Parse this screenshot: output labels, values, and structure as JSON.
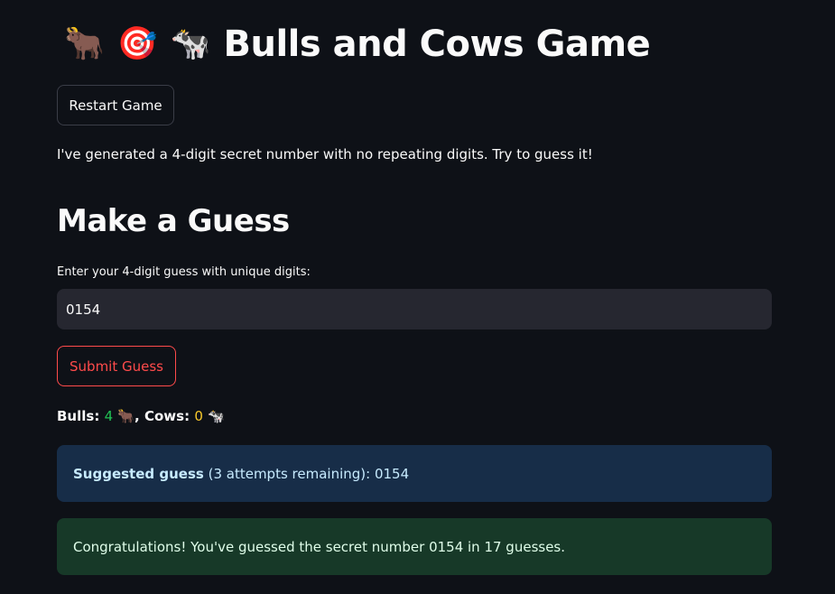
{
  "header": {
    "icons": [
      "bull-emoji",
      "dart-target-emoji",
      "cow-emoji"
    ],
    "icon_glyphs": [
      "🐂",
      "🎯",
      "🐄"
    ],
    "title": "Bulls and Cows Game"
  },
  "restart_button": {
    "label": "Restart Game"
  },
  "intro_text": "I've generated a 4-digit secret number with no repeating digits. Try to guess it!",
  "guess_section": {
    "heading": "Make a Guess",
    "input_label": "Enter your 4-digit guess with unique digits:",
    "input_value": "0154",
    "submit_label": "Submit Guess"
  },
  "result": {
    "bulls_label": "Bulls:",
    "bulls_value": "4",
    "bulls_icon": "🐂",
    "separator": ",",
    "cows_label": "Cows:",
    "cows_value": "0",
    "cows_icon": "🐄"
  },
  "suggestion": {
    "bold_label": "Suggested guess",
    "detail": "(3 attempts remaining): 0154"
  },
  "success_message": "Congratulations! You've guessed the secret number 0154 in 17 guesses.",
  "colors": {
    "background": "#0e1117",
    "input_background": "#262730",
    "accent_red": "#ff4b4b",
    "bulls_green": "#21c354",
    "cows_yellow": "#faca2b",
    "info_background": "#172d48",
    "success_background": "#173928"
  }
}
